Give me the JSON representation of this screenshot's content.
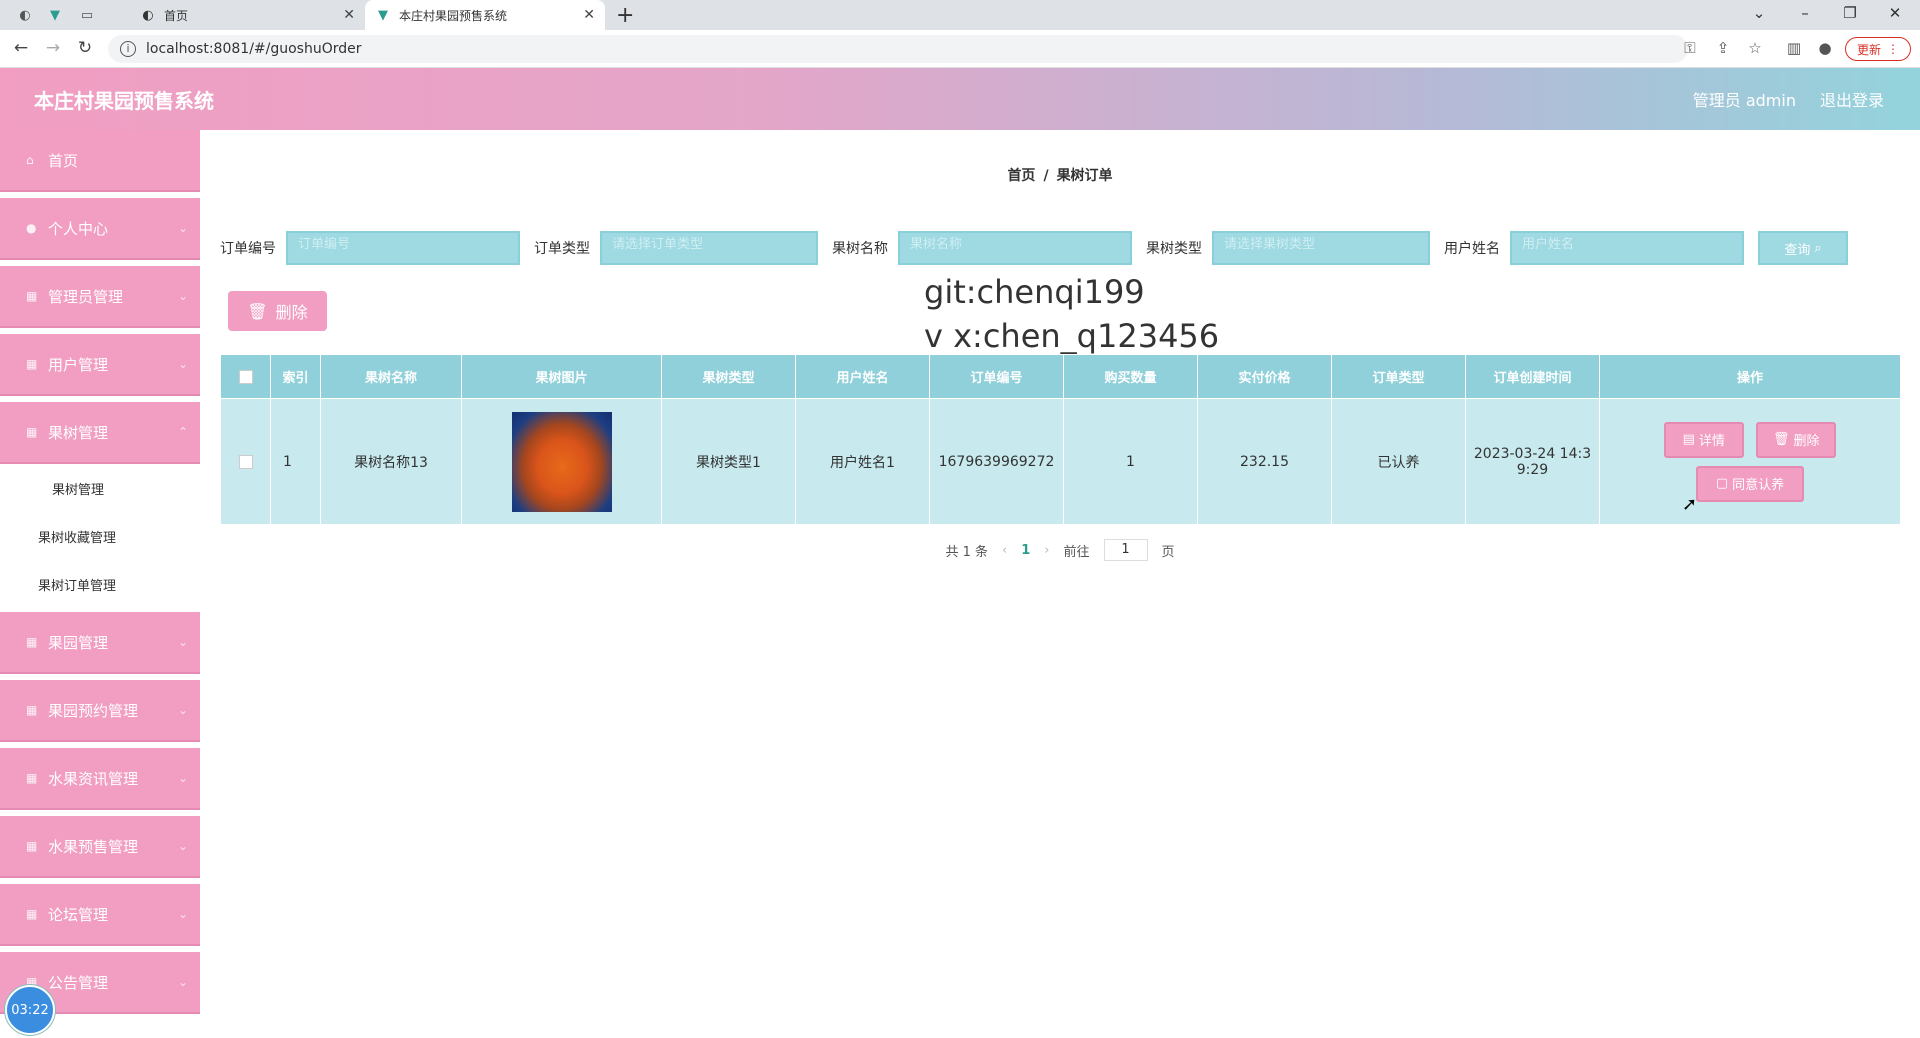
{
  "browser": {
    "tabs": [
      {
        "label": "首页",
        "active": false
      },
      {
        "label": "本庄村果园预售系统",
        "active": true
      }
    ],
    "url": "localhost:8081/#/guoshuOrder",
    "update_label": "更新"
  },
  "header": {
    "title": "本庄村果园预售系统",
    "user_label": "管理员 admin",
    "logout_label": "退出登录"
  },
  "sidebar": {
    "items": [
      {
        "label": "首页"
      },
      {
        "label": "个人中心"
      },
      {
        "label": "管理员管理"
      },
      {
        "label": "用户管理"
      },
      {
        "label": "果树管理"
      }
    ],
    "submenu": [
      {
        "label": "果树管理"
      },
      {
        "label": "果树收藏管理"
      },
      {
        "label": "果树订单管理"
      }
    ],
    "items_after": [
      {
        "label": "果园管理"
      },
      {
        "label": "果园预约管理"
      },
      {
        "label": "水果资讯管理"
      },
      {
        "label": "水果预售管理"
      },
      {
        "label": "论坛管理"
      },
      {
        "label": "公告管理"
      }
    ],
    "timer": "03:22"
  },
  "breadcrumb": {
    "home": "首页",
    "current": "果树订单"
  },
  "search": {
    "fields": [
      {
        "label": "订单编号",
        "placeholder": "订单编号"
      },
      {
        "label": "订单类型",
        "placeholder": "请选择订单类型"
      },
      {
        "label": "果树名称",
        "placeholder": "果树名称"
      },
      {
        "label": "果树类型",
        "placeholder": "请选择果树类型"
      },
      {
        "label": "用户姓名",
        "placeholder": "用户姓名"
      }
    ],
    "query_label": "查询"
  },
  "actions": {
    "delete_label": "删除"
  },
  "watermark": {
    "line1": "git:chenqi199",
    "line2": "v x:chen_q123456"
  },
  "table": {
    "columns": [
      "索引",
      "果树名称",
      "果树图片",
      "果树类型",
      "用户姓名",
      "订单编号",
      "购买数量",
      "实付价格",
      "订单类型",
      "订单创建时间",
      "操作"
    ],
    "rows": [
      {
        "index": "1",
        "name": "果树名称13",
        "type": "果树类型1",
        "user": "用户姓名1",
        "order_no": "1679639969272",
        "qty": "1",
        "price": "232.15",
        "order_type": "已认养",
        "created_line1": "2023-03-24 14:3",
        "created_line2": "9:29",
        "btn_detail": "详情",
        "btn_delete": "删除",
        "btn_agree": "同意认养"
      }
    ]
  },
  "pager": {
    "total": "共 1 条",
    "page": "1",
    "goto": "前往",
    "goto_value": "1",
    "page_suffix": "页"
  }
}
